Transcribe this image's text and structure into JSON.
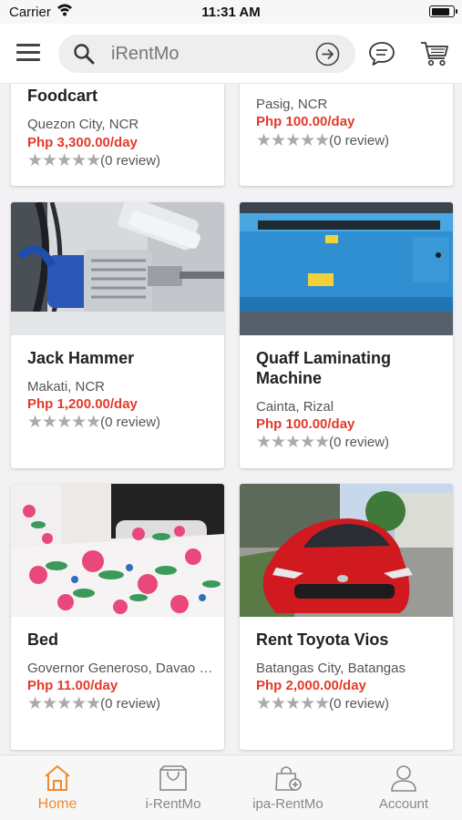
{
  "status_bar": {
    "carrier": "Carrier",
    "time": "11:31 AM",
    "battery_level": 0.9
  },
  "search": {
    "placeholder": "iRentMo"
  },
  "review_text": "(0 review)",
  "products": [
    {
      "title": "Foodcart",
      "location": "Quezon City, NCR",
      "price": "Php 3,300.00/day",
      "rating": "(0 review)"
    },
    {
      "title": "",
      "location": "Pasig, NCR",
      "price": "Php 100.00/day",
      "rating": "(0 review)"
    },
    {
      "title": "Jack Hammer",
      "location": "Makati, NCR",
      "price": "Php 1,200.00/day",
      "rating": "(0 review)"
    },
    {
      "title": "Quaff Laminating Machine",
      "location": "Cainta, Rizal",
      "price": "Php 100.00/day",
      "rating": "(0 review)"
    },
    {
      "title": "Bed",
      "location": "Governor Generoso, Davao Oriental",
      "price": "Php 11.00/day",
      "rating": "(0 review)"
    },
    {
      "title": "Rent Toyota Vios",
      "location": "Batangas City, Batangas",
      "price": "Php 2,000.00/day",
      "rating": "(0 review)"
    }
  ],
  "bottom_nav": [
    {
      "label": "Home",
      "icon": "home-icon",
      "active": true
    },
    {
      "label": "i-RentMo",
      "icon": "bag-icon",
      "active": false
    },
    {
      "label": "ipa-RentMo",
      "icon": "lock-bag-icon",
      "active": false
    },
    {
      "label": "Account",
      "icon": "user-icon",
      "active": false
    }
  ],
  "colors": {
    "accent": "#f08a2c",
    "price": "#e23b2a",
    "star": "#aaaaaa"
  }
}
